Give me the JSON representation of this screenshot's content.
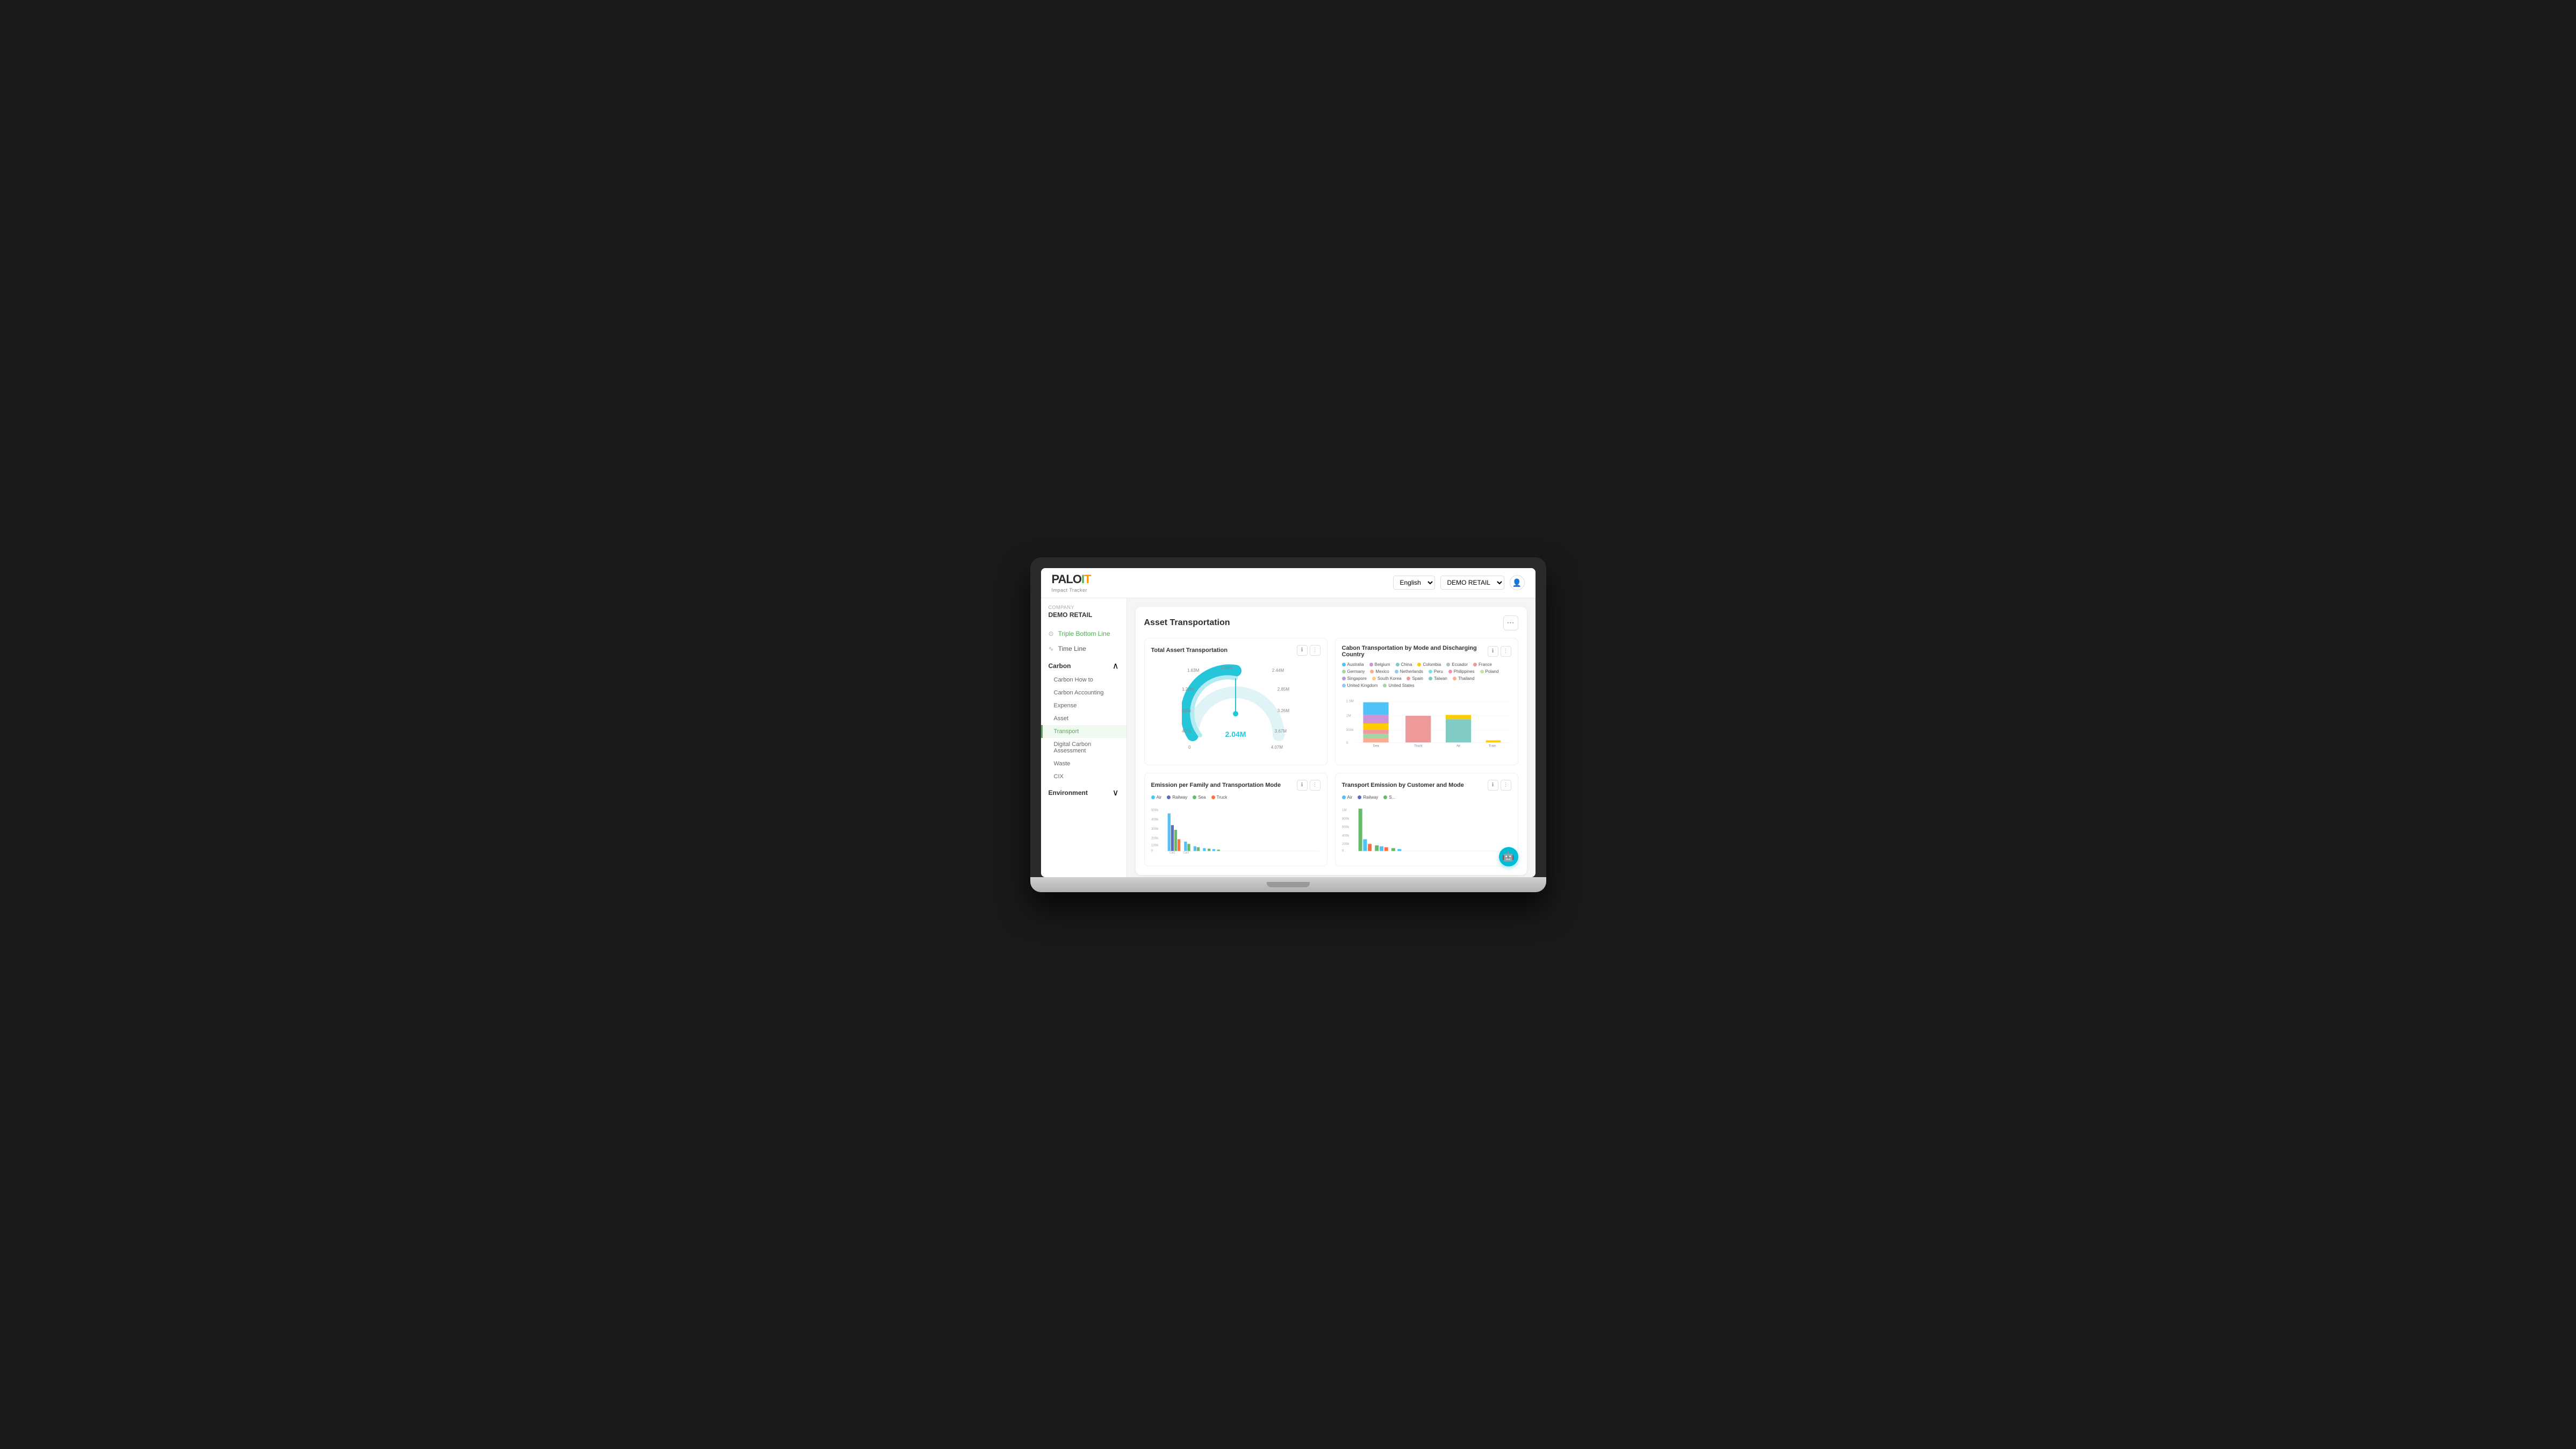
{
  "topbar": {
    "logo": {
      "palo": "PALO",
      "it": "IT",
      "subtitle": "Impact Tracker"
    },
    "lang_label": "English",
    "demo_label": "DEMO RETAIL",
    "user_icon": "👤"
  },
  "sidebar": {
    "company_label": "Company",
    "company_name": "DEMO RETAIL",
    "nav_items": [
      {
        "id": "triple-bottom-line",
        "label": "Triple Bottom Line",
        "active": true,
        "icon": "⊙"
      },
      {
        "id": "time-line",
        "label": "Time Line",
        "active": false,
        "icon": "∿"
      }
    ],
    "sections": [
      {
        "label": "Carbon",
        "expanded": true,
        "sub_items": [
          {
            "id": "carbon-how-to",
            "label": "Carbon How to",
            "active": false
          },
          {
            "id": "carbon-accounting",
            "label": "Carbon Accounting",
            "active": false
          },
          {
            "id": "expense",
            "label": "Expense",
            "active": false
          },
          {
            "id": "asset",
            "label": "Asset",
            "active": false
          },
          {
            "id": "transport",
            "label": "Transport",
            "active": true
          },
          {
            "id": "digital-carbon",
            "label": "Digital Carbon Assessment",
            "active": false
          },
          {
            "id": "waste",
            "label": "Waste",
            "active": false
          },
          {
            "id": "cix",
            "label": "CIX",
            "active": false
          }
        ]
      },
      {
        "label": "Environment",
        "expanded": false,
        "sub_items": []
      }
    ]
  },
  "content": {
    "title": "Asset Transportation",
    "more_btn_label": "⋯",
    "charts": {
      "gauge": {
        "title": "Total Assert Transportation",
        "center_value": "2.04M",
        "labels": {
          "top": "2.04M",
          "top_right": "2.44M",
          "right_top": "2.85M",
          "right": "3.26M",
          "right_bottom": "3.67M",
          "bottom": "4.07M",
          "bottom_left": "0",
          "left_bottom": "407k",
          "left": "815k",
          "left_top": "1.22M",
          "top_left": "1.63M"
        }
      },
      "bar_country": {
        "title": "Cabon Transportation by Mode and Discharging Country",
        "y_labels": [
          "0",
          "500k",
          "1M",
          "1.5M"
        ],
        "x_labels": [
          "Sea",
          "Truck",
          "Air",
          "Train"
        ],
        "legend": [
          {
            "label": "Australia",
            "color": "#4FC3F7"
          },
          {
            "label": "Belgium",
            "color": "#CE93D8"
          },
          {
            "label": "China",
            "color": "#80CBC4"
          },
          {
            "label": "Colombia",
            "color": "#FFCC02"
          },
          {
            "label": "Ecuador",
            "color": "#B0BEC5"
          },
          {
            "label": "France",
            "color": "#EF9A9A"
          },
          {
            "label": "Germany",
            "color": "#A5D6A7"
          },
          {
            "label": "Mexico",
            "color": "#FFAB91"
          },
          {
            "label": "Netherlands",
            "color": "#90CAF9"
          },
          {
            "label": "Peru",
            "color": "#80DEEA"
          },
          {
            "label": "Philippines",
            "color": "#F48FB1"
          },
          {
            "label": "Poland",
            "color": "#C5E1A5"
          },
          {
            "label": "Singapore",
            "color": "#B39DDB"
          },
          {
            "label": "South Korea",
            "color": "#FFCC80"
          },
          {
            "label": "Spain",
            "color": "#EF9A9A"
          },
          {
            "label": "Taiwan",
            "color": "#80CBC4"
          },
          {
            "label": "Thailand",
            "color": "#FFAB91"
          },
          {
            "label": "United Kingdom",
            "color": "#90CAF9"
          },
          {
            "label": "United States",
            "color": "#A5D6A7"
          }
        ]
      },
      "emission_family": {
        "title": "Emission per Family and Transportation Mode",
        "legend": [
          {
            "label": "Air",
            "color": "#4FC3F7"
          },
          {
            "label": "Railway",
            "color": "#5C6BC0"
          },
          {
            "label": "Sea",
            "color": "#66BB6A"
          },
          {
            "label": "Truck",
            "color": "#FF7043"
          }
        ],
        "y_labels": [
          "0",
          "100k",
          "200k",
          "300k",
          "400k",
          "500k"
        ]
      },
      "transport_customer": {
        "title": "Transport Emission by Customer and Mode",
        "legend": [
          {
            "label": "Air",
            "color": "#4FC3F7"
          },
          {
            "label": "Railway",
            "color": "#5C6BC0"
          },
          {
            "label": "S...",
            "color": "#66BB6A"
          }
        ],
        "y_labels": [
          "0",
          "200k",
          "400k",
          "600k",
          "800k",
          "1M"
        ]
      }
    }
  },
  "ai_bot": {
    "label": "🤖"
  }
}
